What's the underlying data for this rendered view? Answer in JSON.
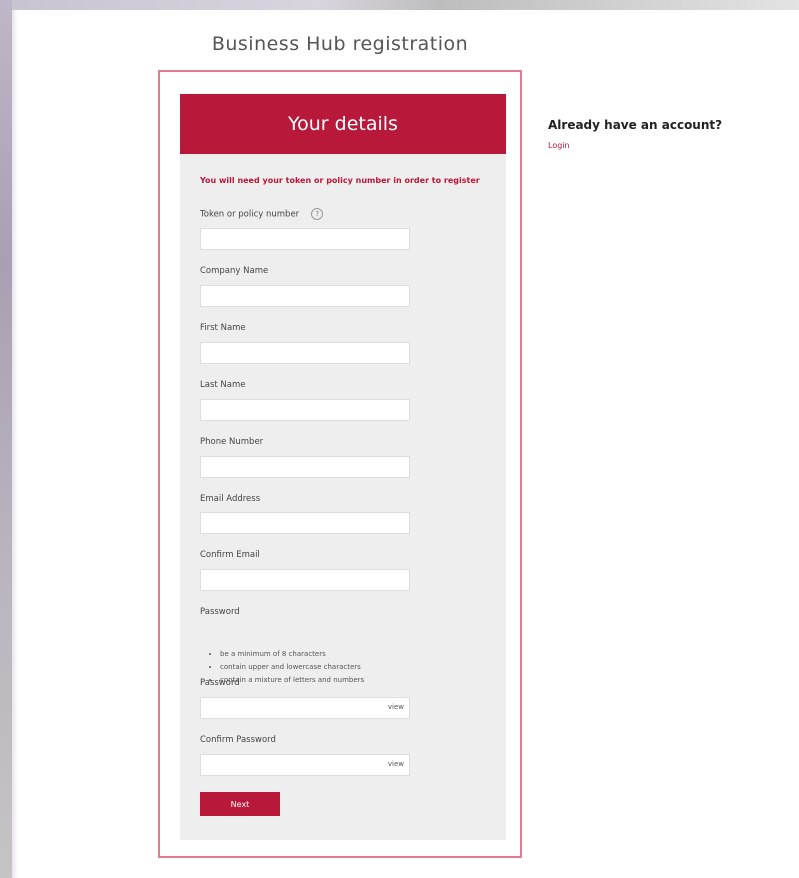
{
  "page": {
    "title": "Business Hub registration"
  },
  "form": {
    "header": "Your details",
    "notice": "You will need your token or policy number in order to register",
    "fields": {
      "token": {
        "label": "Token or policy number",
        "value": "",
        "placeholder": ""
      },
      "company": {
        "label": "Company Name",
        "value": "",
        "placeholder": ""
      },
      "first_name": {
        "label": "First Name",
        "value": "",
        "placeholder": ""
      },
      "last_name": {
        "label": "Last Name",
        "value": "",
        "placeholder": ""
      },
      "phone": {
        "label": "Phone Number",
        "value": "",
        "placeholder": ""
      },
      "email": {
        "label": "Email Address",
        "value": "",
        "placeholder": ""
      },
      "confirm_email": {
        "label": "Confirm Email",
        "value": "",
        "placeholder": ""
      }
    },
    "password_section": {
      "heading": "Password",
      "rules": [
        "be a minimum of 8 characters",
        "contain upper and lowercase characters",
        "contain a mixture of letters and numbers"
      ],
      "password_label": "Password",
      "confirm_label": "Confirm Password",
      "view_label": "view"
    },
    "next_label": "Next"
  },
  "sidebar": {
    "heading": "Already have an account?",
    "login_label": "Login"
  },
  "colors": {
    "brand": "#b8183a",
    "border": "#e07c8e",
    "panel": "#eeeeee"
  },
  "icons": {
    "info": "info-icon"
  }
}
